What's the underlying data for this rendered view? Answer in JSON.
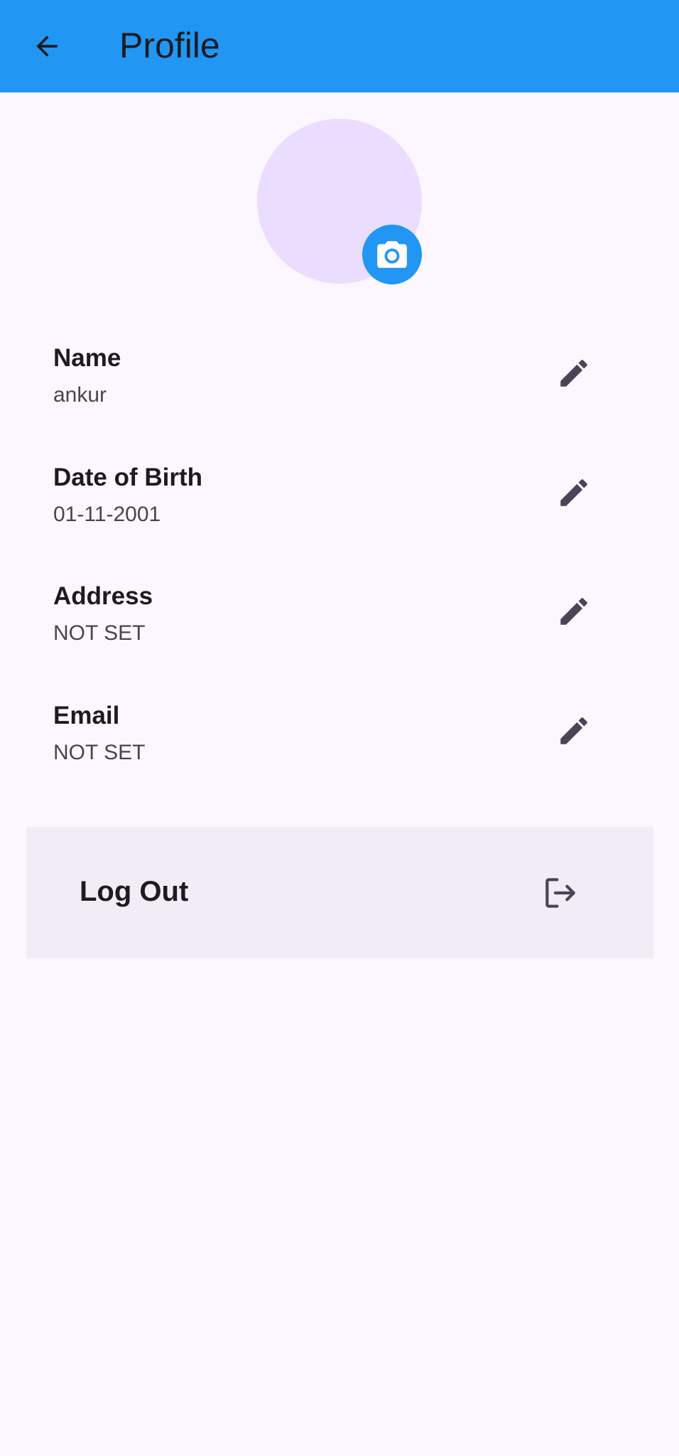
{
  "app_bar": {
    "title": "Profile",
    "back_icon": "arrow-back-icon",
    "color": "#2196f3"
  },
  "avatar": {
    "color": "#eaddfe",
    "camera_icon": "camera-icon"
  },
  "fields": [
    {
      "label": "Name",
      "value": "ankur",
      "edit_icon": "pencil-icon"
    },
    {
      "label": "Date of Birth",
      "value": "01-11-2001",
      "edit_icon": "pencil-icon"
    },
    {
      "label": "Address",
      "value": "NOT SET",
      "edit_icon": "pencil-icon"
    },
    {
      "label": "Email",
      "value": "NOT SET",
      "edit_icon": "pencil-icon"
    }
  ],
  "logout": {
    "label": "Log Out",
    "icon": "logout-icon"
  }
}
